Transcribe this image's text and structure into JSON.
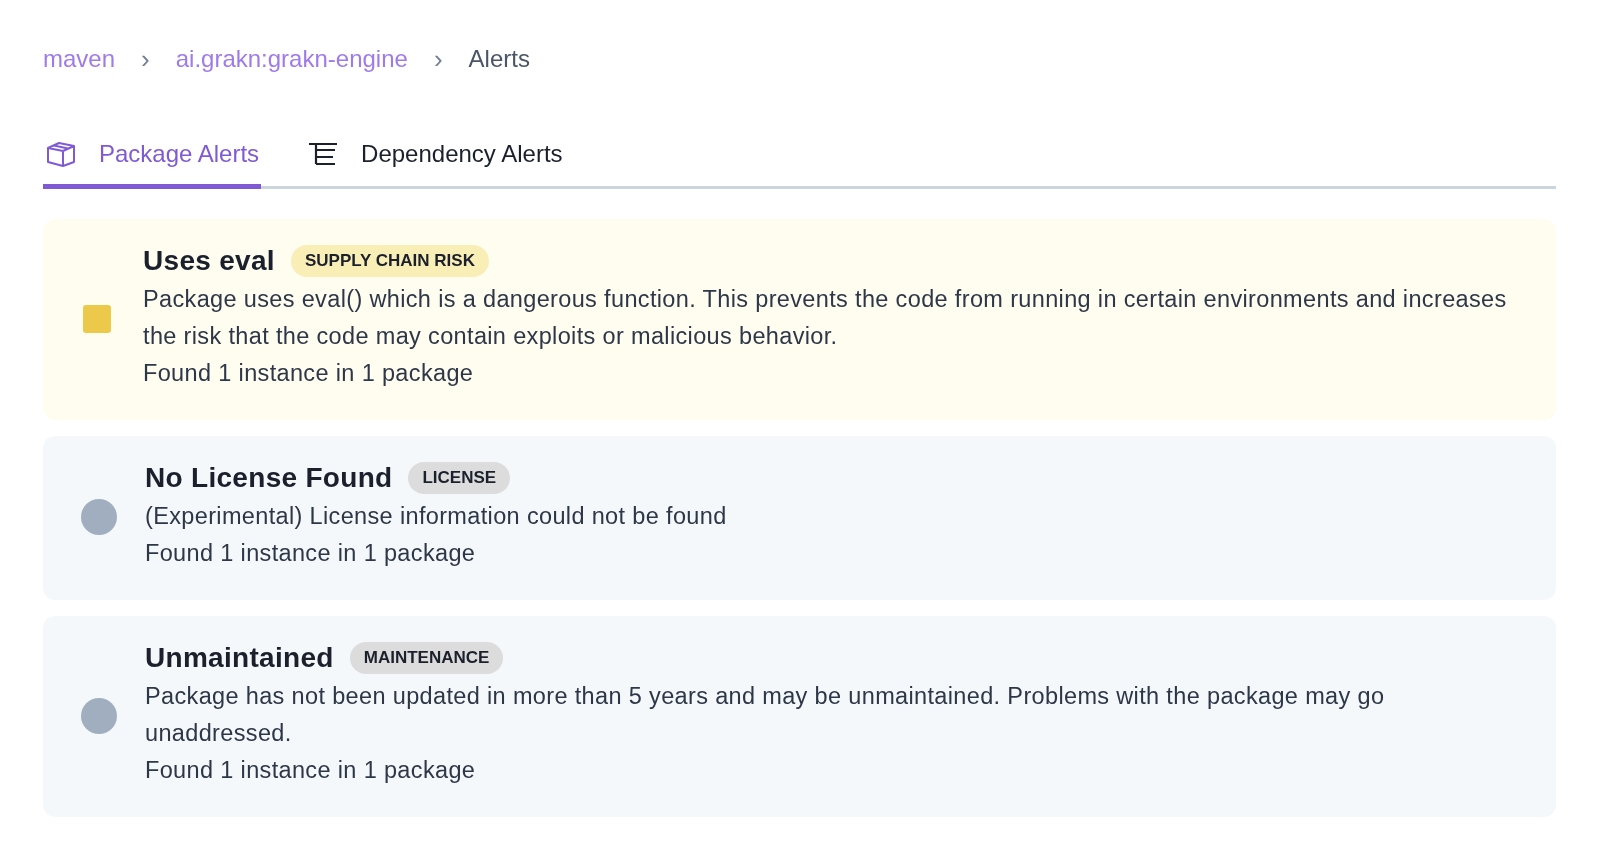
{
  "breadcrumb": [
    {
      "label": "maven",
      "link": true
    },
    {
      "label": "ai.grakn:grakn-engine",
      "link": true
    },
    {
      "label": "Alerts",
      "link": false
    }
  ],
  "breadcrumb_separator": "›",
  "tabs": [
    {
      "label": "Package Alerts",
      "kind": "package",
      "selected": true
    },
    {
      "label": "Dependency Alerts",
      "kind": "tree",
      "selected": false
    }
  ],
  "alerts": [
    {
      "kind": "warning",
      "color": "#ecc94b",
      "title": "Uses eval",
      "badge": "SUPPLY CHAIN RISK",
      "description": "Package uses eval() which is a dangerous function. This prevents the code from running in certain environments and increases the risk that the code may contain exploits or malicious behavior.",
      "found": "Found 1 instance in 1 package"
    },
    {
      "kind": "info",
      "color": "#a0aec0",
      "title": "No License Found",
      "badge": "LICENSE",
      "description": "(Experimental) License information could not be found",
      "found": "Found 1 instance in 1 package"
    },
    {
      "kind": "info",
      "color": "#a0aec0",
      "title": "Unmaintained",
      "badge": "MAINTENANCE",
      "description": "Package has not been updated in more than 5 years and may be unmaintained. Problems with the package may go unaddressed.",
      "found": "Found 1 instance in 1 package"
    }
  ]
}
